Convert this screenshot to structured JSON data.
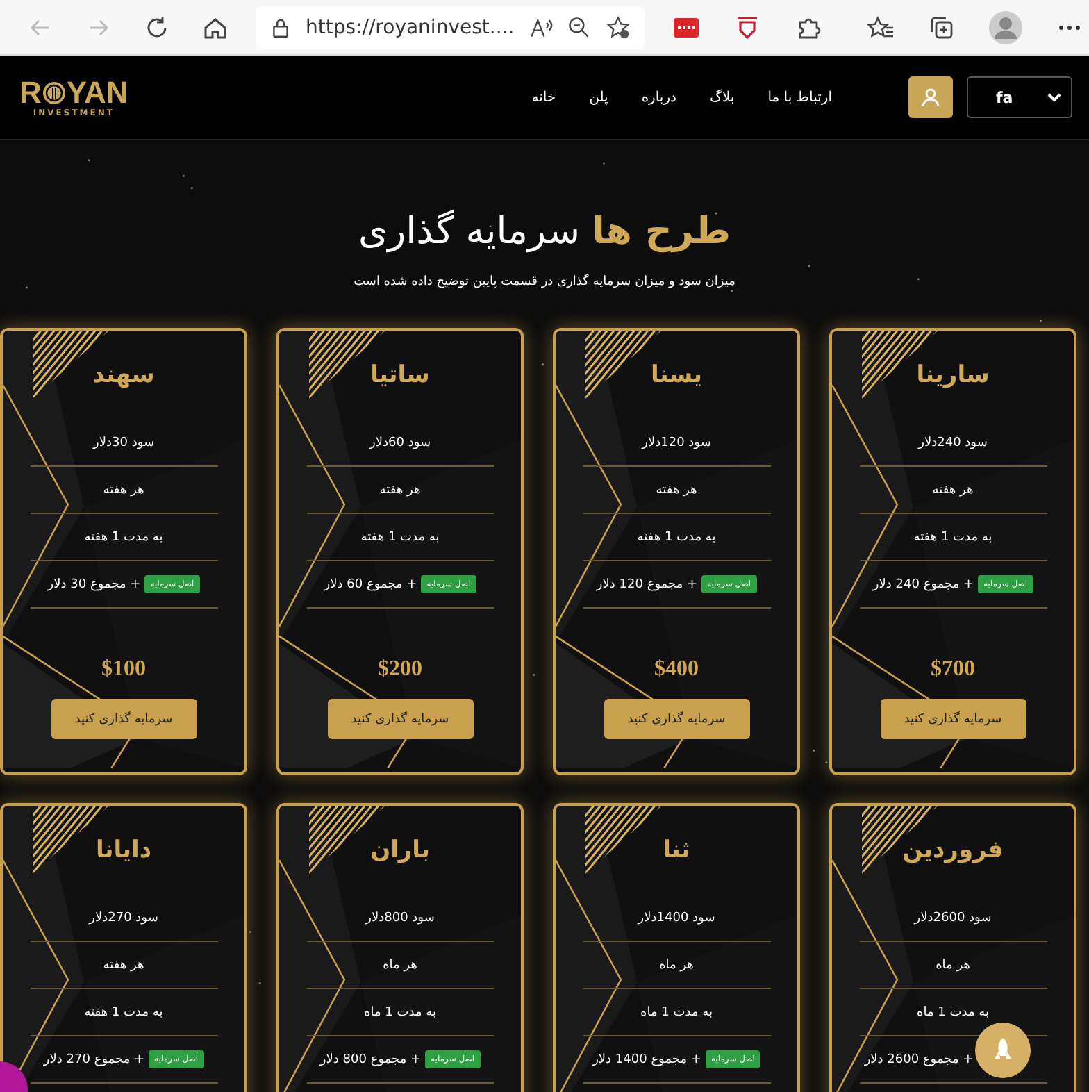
{
  "browser": {
    "url": "https://royaninvest...."
  },
  "nav": {
    "logo": {
      "start": "R",
      "end": "YAN",
      "tagline": "INVESTMENT"
    },
    "links": [
      "ارتباط با ما",
      "بلاگ",
      "درباره",
      "پلن",
      "خانه"
    ],
    "language": "fa"
  },
  "hero": {
    "title_highlight": "طرح ها",
    "title_rest": "سرمایه گذاری",
    "subtitle": "میزان سود و میزان سرمایه گذاری در قسمت پایین توضیح داده شده است"
  },
  "plans": [
    {
      "name": "سارینا",
      "profit": "سود 240دلار",
      "frequency": "هر هفته",
      "duration": "به مدت 1 هفته",
      "badge": "اصل سرمایه",
      "total": "+ مجموع 240 دلار",
      "price": "$700",
      "button": "سرمایه گذاری کنید"
    },
    {
      "name": "یسنا",
      "profit": "سود 120دلار",
      "frequency": "هر هفته",
      "duration": "به مدت 1 هفته",
      "badge": "اصل سرمایه",
      "total": "+ مجموع 120 دلار",
      "price": "$400",
      "button": "سرمایه گذاری کنید"
    },
    {
      "name": "ساتیا",
      "profit": "سود 60دلار",
      "frequency": "هر هفته",
      "duration": "به مدت 1 هفته",
      "badge": "اصل سرمایه",
      "total": "+ مجموع 60 دلار",
      "price": "$200",
      "button": "سرمایه گذاری کنید"
    },
    {
      "name": "سهند",
      "profit": "سود 30دلار",
      "frequency": "هر هفته",
      "duration": "به مدت 1 هفته",
      "badge": "اصل سرمایه",
      "total": "+ مجموع 30 دلار",
      "price": "$100",
      "button": "سرمایه گذاری کنید"
    },
    {
      "name": "فروردین",
      "profit": "سود 2600دلار",
      "frequency": "هر ماه",
      "duration": "به مدت 1 ماه",
      "total": "+ مجموع 2600 دلار"
    },
    {
      "name": "ثنا",
      "profit": "سود 1400دلار",
      "frequency": "هر ماه",
      "duration": "به مدت 1 ماه",
      "badge": "اصل سرمایه",
      "total": "+ مجموع 1400 دلار"
    },
    {
      "name": "باران",
      "profit": "سود 800دلار",
      "frequency": "هر ماه",
      "duration": "به مدت 1 ماه",
      "badge": "اصل سرمایه",
      "total": "+ مجموع 800 دلار"
    },
    {
      "name": "دایانا",
      "profit": "سود 270دلار",
      "frequency": "هر هفته",
      "duration": "به مدت 1 هفته",
      "badge": "اصل سرمایه",
      "total": "+ مجموع 270 دلار"
    }
  ]
}
